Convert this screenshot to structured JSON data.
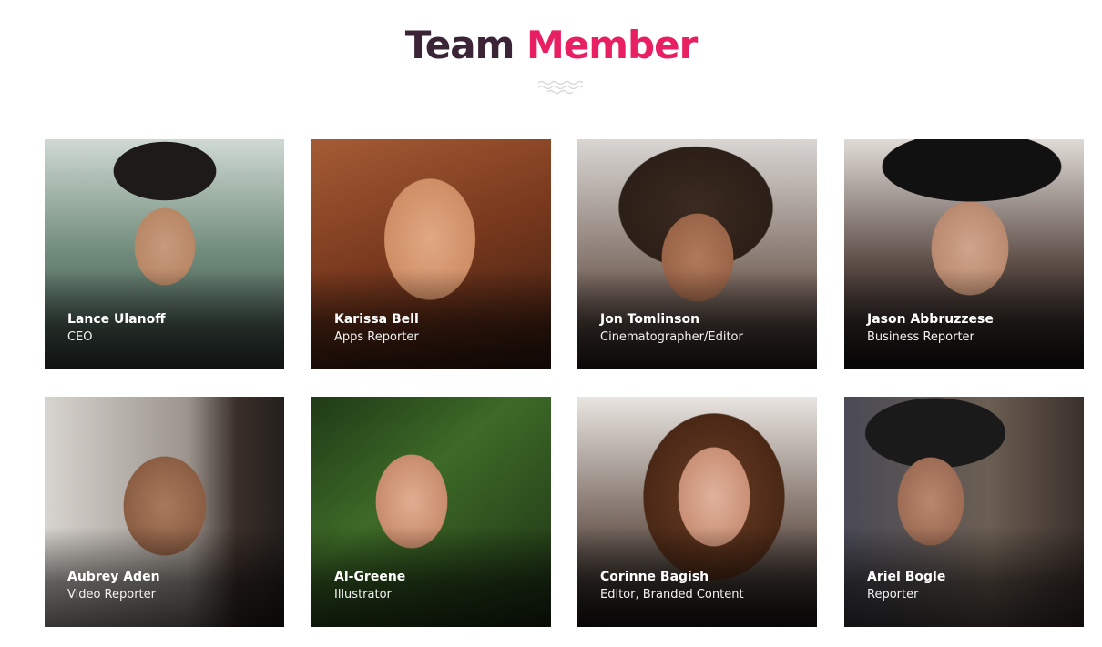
{
  "heading": {
    "part1": "Team",
    "part2": "Member"
  },
  "colors": {
    "heading_dark": "#3a2436",
    "heading_accent": "#e81f63",
    "divider": "#d9d9d9"
  },
  "members": [
    {
      "name": "Lance Ulanoff",
      "role": "CEO"
    },
    {
      "name": "Karissa Bell",
      "role": "Apps Reporter"
    },
    {
      "name": "Jon Tomlinson",
      "role": "Cinematographer/Editor"
    },
    {
      "name": "Jason Abbruzzese",
      "role": "Business Reporter"
    },
    {
      "name": "Aubrey Aden",
      "role": "Video Reporter"
    },
    {
      "name": "Al-Greene",
      "role": "Illustrator"
    },
    {
      "name": "Corinne Bagish",
      "role": "Editor, Branded Content"
    },
    {
      "name": "Ariel Bogle",
      "role": "Reporter"
    }
  ]
}
